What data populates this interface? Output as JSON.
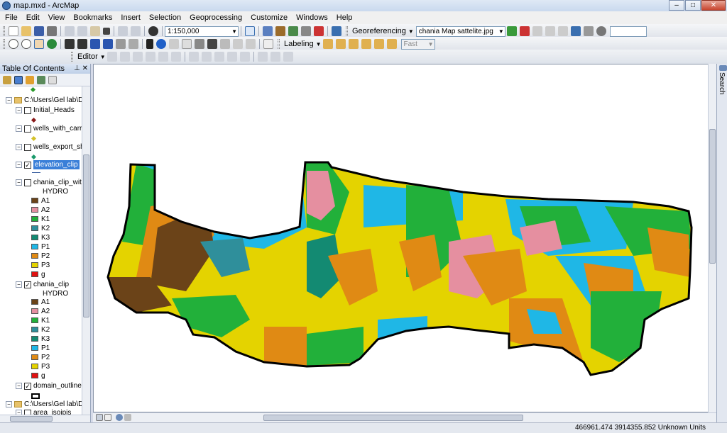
{
  "window": {
    "title": "map.mxd - ArcMap",
    "minimize": "–",
    "maximize": "□",
    "close": "✕"
  },
  "menu": [
    "File",
    "Edit",
    "View",
    "Bookmarks",
    "Insert",
    "Selection",
    "Geoprocessing",
    "Customize",
    "Windows",
    "Help"
  ],
  "toolbar": {
    "scale": "1:150,000",
    "georef_label": "Georeferencing",
    "georef_layer": "chania Map sattelite.jpg",
    "labeling_label": "Labeling",
    "fast_label": "Fast",
    "editor_label": "Editor"
  },
  "toc": {
    "title": "Table Of Contents",
    "pin": "⊥",
    "close": "✕",
    "items": [
      {
        "label": "C:\\Users\\Gel lab\\Drop"
      },
      {
        "label": "Initial_Heads"
      },
      {
        "label": "wells_with_carrots"
      },
      {
        "label": "wells_export_shp"
      },
      {
        "label": "elevation_clip"
      },
      {
        "label": "chania_clip_with_"
      },
      {
        "label": "HYDRO"
      },
      {
        "label": "chania_clip"
      },
      {
        "label": "HYDRO"
      },
      {
        "label": "domain_outline"
      },
      {
        "label": "C:\\Users\\Gel lab\\Drop"
      },
      {
        "label": "area_isoipis"
      }
    ],
    "legend1": [
      "A1",
      "A2",
      "K1",
      "K2",
      "K3",
      "P1",
      "P2",
      "P3",
      "g"
    ],
    "legend2": [
      "A1",
      "A2",
      "K1",
      "K2",
      "K3",
      "P1",
      "P2",
      "P3",
      "g"
    ],
    "legend_colors": [
      "#6b4318",
      "#e58fa0",
      "#22b03a",
      "#2f8f9b",
      "#138a72",
      "#1fb7e6",
      "#e08a14",
      "#e4d300",
      "#e01212"
    ]
  },
  "search_pane": {
    "label": "Search"
  },
  "status": {
    "coords": "466961.474  3914355.852 Unknown Units"
  }
}
